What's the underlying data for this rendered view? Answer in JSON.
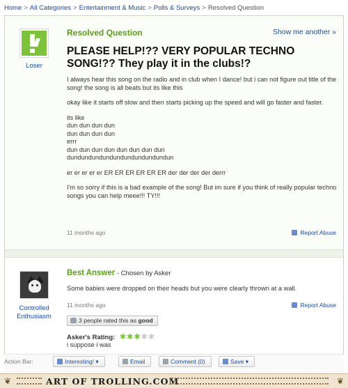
{
  "breadcrumb": {
    "items": [
      "Home",
      "All Categories",
      "Entertainment & Music",
      "Polls & Surveys"
    ],
    "current": "Resolved Question"
  },
  "question": {
    "status_label": "Resolved Question",
    "show_another": "Show me another »",
    "asker_name": "Loser",
    "title": "PLEASE HELP!?? VERY POPULAR TECHNO SONG!?? They play it in the clubs!?",
    "body_p1": "I always hear this song on the radio and in club when I dance! but i can not figure out title of the song! the song is all beats but its like this",
    "body_p2": "okay like it starts off slow and then starts picking up the speed and will go faster and faster.",
    "body_lines": [
      "its like",
      "dun dun dun dun",
      "dun dun dun dun",
      "errr",
      "dun dun dun dun dun dun dun dun",
      "dundundundundundundundundundun"
    ],
    "body_p3": "er er er er er ER ER ER ER ER ER der der der der derrr",
    "body_p4": "I'm so sorry if this is a bad example of the song! But im sure if you think of really popular techno songs you can help meee!!! TY!!!",
    "time_ago": "11 months ago",
    "report_abuse": "Report Abuse"
  },
  "answer": {
    "answerer_name_line1": "Controlled",
    "answerer_name_line2": "Enthusiasm",
    "best_answer_label": "Best Answer",
    "chosen_by": " - Chosen by Asker",
    "text": "Some babies were dropped on their heads but you were clearly thrown at a wall.",
    "time_ago": "11 months ago",
    "report_abuse": "Report Abuse",
    "rated_prefix": "3 people rated this as ",
    "rated_value": "good",
    "rating_label": "Asker's Rating:",
    "rating_stars": 3,
    "rating_max": 5,
    "rating_comment": "i suppose i was"
  },
  "action_bar": {
    "label": "Action Bar:",
    "interesting": "Interesting!",
    "email": "Email",
    "comment": "Comment (0)",
    "save": "Save"
  },
  "footer": {
    "brand": "ART OF TROLLING.COM"
  },
  "colors": {
    "link": "#1a4aa8",
    "green": "#5aa016",
    "star_on": "#7cc23a"
  }
}
